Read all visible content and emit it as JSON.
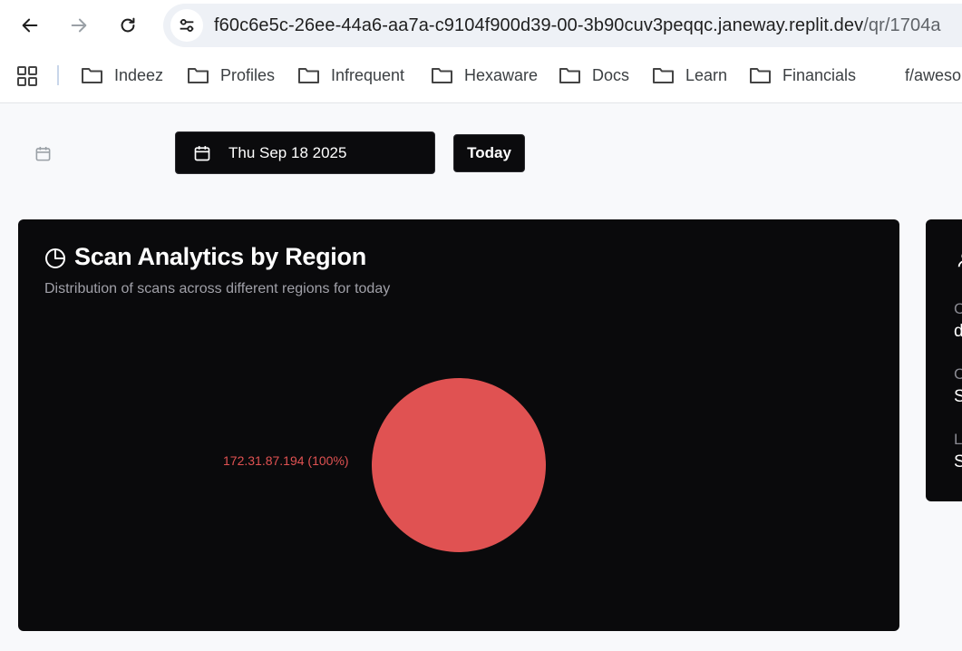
{
  "browser": {
    "url_host": "f60c6e5c-26ee-44a6-aa7a-c9104f900d39-00-3b90cuv3peqqc.janeway.replit.dev",
    "url_path": "/qr/1704a",
    "bookmarks": [
      {
        "label": "Indeez",
        "icon": "folder-icon"
      },
      {
        "label": "Profiles",
        "icon": "folder-icon"
      },
      {
        "label": "Infrequent",
        "icon": "folder-icon"
      },
      {
        "label": "Hexaware",
        "icon": "folder-icon"
      },
      {
        "label": "Docs",
        "icon": "folder-icon"
      },
      {
        "label": "Learn",
        "icon": "folder-icon"
      },
      {
        "label": "Financials",
        "icon": "folder-icon"
      },
      {
        "label": "f/aweso",
        "icon": ""
      }
    ]
  },
  "toolbar": {
    "date_label": "Thu Sep 18 2025",
    "today_label": "Today"
  },
  "analytics": {
    "title": "Scan Analytics by Region",
    "subtitle": "Distribution of scans across different regions for today"
  },
  "chart_data": {
    "type": "pie",
    "categories": [
      "172.31.87.194"
    ],
    "values": [
      100
    ],
    "labels": [
      "172.31.87.194 (100%)"
    ],
    "colors": [
      "#e05252"
    ]
  },
  "side_panel": {
    "fragments": [
      "C",
      "d",
      "C",
      "S",
      "L",
      "S"
    ]
  },
  "colors": {
    "card_bg": "#0a0a0c",
    "accent": "#e05252"
  }
}
